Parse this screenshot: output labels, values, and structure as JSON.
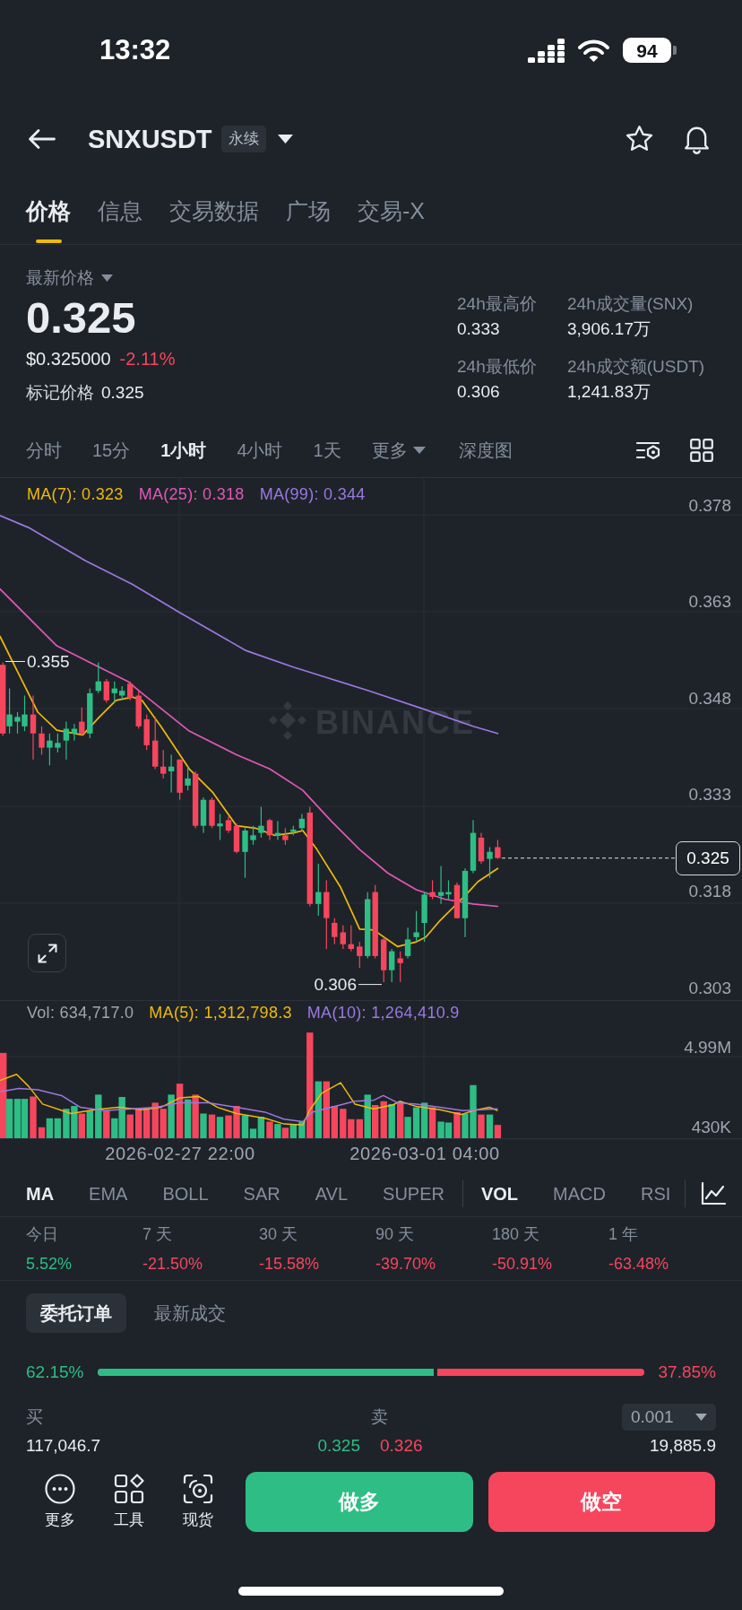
{
  "status_bar": {
    "time": "13:32",
    "battery": "94"
  },
  "header": {
    "symbol": "SNXUSDT",
    "badge": "永续"
  },
  "tabs": [
    {
      "label": "价格",
      "selected": true
    },
    {
      "label": "信息",
      "selected": false
    },
    {
      "label": "交易数据",
      "selected": false
    },
    {
      "label": "广场",
      "selected": false
    },
    {
      "label": "交易-X",
      "selected": false
    }
  ],
  "price_summary": {
    "label": "最新价格",
    "price": "0.325",
    "usd_price": "$0.325000",
    "change": "-2.11%",
    "change_positive": false,
    "mark_label": "标记价格",
    "mark_price": "0.325",
    "stats": [
      {
        "label": "24h最高价",
        "value": "0.333"
      },
      {
        "label": "24h成交量(SNX)",
        "value": "3,906.17万"
      },
      {
        "label": "24h最低价",
        "value": "0.306"
      },
      {
        "label": "24h成交额(USDT)",
        "value": "1,241.83万"
      }
    ]
  },
  "intervals": [
    {
      "label": "分时",
      "kind": "interval",
      "selected": false
    },
    {
      "label": "15分",
      "kind": "interval",
      "selected": false
    },
    {
      "label": "1小时",
      "kind": "interval",
      "selected": true
    },
    {
      "label": "4小时",
      "kind": "interval",
      "selected": false
    },
    {
      "label": "1天",
      "kind": "interval",
      "selected": false
    },
    {
      "label": "更多",
      "kind": "dropdown",
      "selected": false
    },
    {
      "label": "深度图",
      "kind": "view",
      "selected": false
    }
  ],
  "chart": {
    "legend": [
      {
        "label": "MA(7): 0.323",
        "color": "#f0b90b"
      },
      {
        "label": "MA(25): 0.318",
        "color": "#e157b9"
      },
      {
        "label": "MA(99): 0.344",
        "color": "#9b78e3"
      }
    ],
    "price_labels": [
      "0.378",
      "0.363",
      "0.348",
      "0.333",
      "0.318",
      "0.303"
    ],
    "high_label": "0.355",
    "low_label": "0.306",
    "last_price": "0.325",
    "watermark": "BINANCE"
  },
  "volume": {
    "legend": [
      {
        "label": "Vol: 634,717.0",
        "color": "#9ea6b2"
      },
      {
        "label": "MA(5): 1,312,798.3",
        "color": "#f0b90b"
      },
      {
        "label": "MA(10): 1,264,410.9",
        "color": "#9b78e3"
      }
    ],
    "axis_labels": [
      "4.99M",
      "430K"
    ],
    "time_labels": [
      "2026-02-27 22:00",
      "2026-03-01 04:00"
    ]
  },
  "indicators": {
    "main": [
      {
        "label": "MA",
        "selected": true
      },
      {
        "label": "EMA",
        "selected": false
      },
      {
        "label": "BOLL",
        "selected": false
      },
      {
        "label": "SAR",
        "selected": false
      },
      {
        "label": "AVL",
        "selected": false
      },
      {
        "label": "SUPER",
        "selected": false
      }
    ],
    "sub": [
      {
        "label": "VOL",
        "selected": true
      },
      {
        "label": "MACD",
        "selected": false
      },
      {
        "label": "RSI",
        "selected": false
      }
    ]
  },
  "performance": [
    {
      "period": "今日",
      "change": "5.52%",
      "positive": true
    },
    {
      "period": "7 天",
      "change": "-21.50%",
      "positive": false
    },
    {
      "period": "30 天",
      "change": "-15.58%",
      "positive": false
    },
    {
      "period": "90 天",
      "change": "-39.70%",
      "positive": false
    },
    {
      "period": "180 天",
      "change": "-50.91%",
      "positive": false
    },
    {
      "period": "1 年",
      "change": "-63.48%",
      "positive": false
    }
  ],
  "order_tabs": [
    {
      "label": "委托订单",
      "selected": true
    },
    {
      "label": "最新成交",
      "selected": false
    }
  ],
  "order_book": {
    "buy_ratio": "62.15%",
    "sell_ratio": "37.85%",
    "level": 0.6215,
    "buy_label": "买",
    "sell_label": "卖",
    "precision": "0.001",
    "top_row": {
      "bid_quantity": "117,046.7",
      "bid_price": "0.325",
      "ask_price": "0.326",
      "ask_quantity": "19,885.9"
    }
  },
  "bottom_bar": {
    "shortcuts": [
      {
        "label": "更多",
        "kind": "more"
      },
      {
        "label": "工具",
        "kind": "tools"
      },
      {
        "label": "现货",
        "kind": "spot"
      }
    ],
    "actions": [
      {
        "label": "做多",
        "kind": "long"
      },
      {
        "label": "做空",
        "kind": "short"
      }
    ]
  }
}
